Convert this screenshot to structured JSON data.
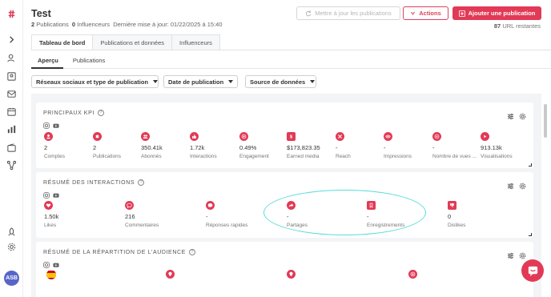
{
  "header": {
    "title": "Test",
    "publications_count": "2",
    "publications_label": "Publications",
    "influencers_count": "0",
    "influencers_label": "Influenceurs",
    "last_update": "Dernière mise à jour: 01/22/2025 à 15:40",
    "update_button": "Mettre à jour les publications",
    "actions_button": "Actions",
    "add_button": "Ajouter une publication",
    "url_count": "87",
    "url_label": "URL restantes"
  },
  "tabs": [
    {
      "label": "Tableau de bord",
      "active": true
    },
    {
      "label": "Publications et données",
      "active": false
    },
    {
      "label": "Influenceurs",
      "active": false
    }
  ],
  "subtabs": [
    {
      "label": "Aperçu",
      "active": true
    },
    {
      "label": "Publications",
      "active": false
    }
  ],
  "filters": [
    {
      "label": "Réseaux sociaux et type de publication"
    },
    {
      "label": "Date de publication"
    },
    {
      "label": "Source de données"
    }
  ],
  "cards": {
    "kpi": {
      "title": "PRINCIPAUX KPI",
      "items": [
        {
          "value": "2",
          "label": "Comptes",
          "icon": "user-icon"
        },
        {
          "value": "2",
          "label": "Publications",
          "icon": "stop-icon"
        },
        {
          "value": "350.41k",
          "label": "Abonnés",
          "icon": "users-icon"
        },
        {
          "value": "1.72k",
          "label": "Interactions",
          "icon": "thumb-icon"
        },
        {
          "value": "0.49%",
          "label": "Engagement",
          "icon": "target-icon"
        },
        {
          "value": "$173,823.35",
          "label": "Earned media",
          "icon": "dollar-icon"
        },
        {
          "value": "-",
          "label": "Reach",
          "icon": "shuffle-icon"
        },
        {
          "value": "-",
          "label": "Impressions",
          "icon": "eye-icon"
        },
        {
          "value": "-",
          "label": "Nombre de vues ...",
          "icon": "play-circle-icon"
        },
        {
          "value": "913.13k",
          "label": "Visualisations",
          "icon": "play-icon"
        }
      ]
    },
    "interactions": {
      "title": "RÉSUMÉ DES INTERACTIONS",
      "items": [
        {
          "value": "1.50k",
          "label": "Likes",
          "icon": "heart-icon"
        },
        {
          "value": "216",
          "label": "Commentaires",
          "icon": "comment-icon"
        },
        {
          "value": "-",
          "label": "Réponses rapides",
          "icon": "reply-icon"
        },
        {
          "value": "-",
          "label": "Partages",
          "icon": "share-icon"
        },
        {
          "value": "-",
          "label": "Enregistrements",
          "icon": "bookmark-icon"
        },
        {
          "value": "0",
          "label": "Dislikes",
          "icon": "dislike-icon"
        }
      ]
    },
    "audience": {
      "title": "RÉSUMÉ DE LA RÉPARTITION DE L'AUDIENCE"
    }
  },
  "colors": {
    "accent": "#e23a56",
    "highlight": "#59dcda",
    "avatar": "#5865c8"
  },
  "avatar": {
    "initials": "ASB"
  }
}
